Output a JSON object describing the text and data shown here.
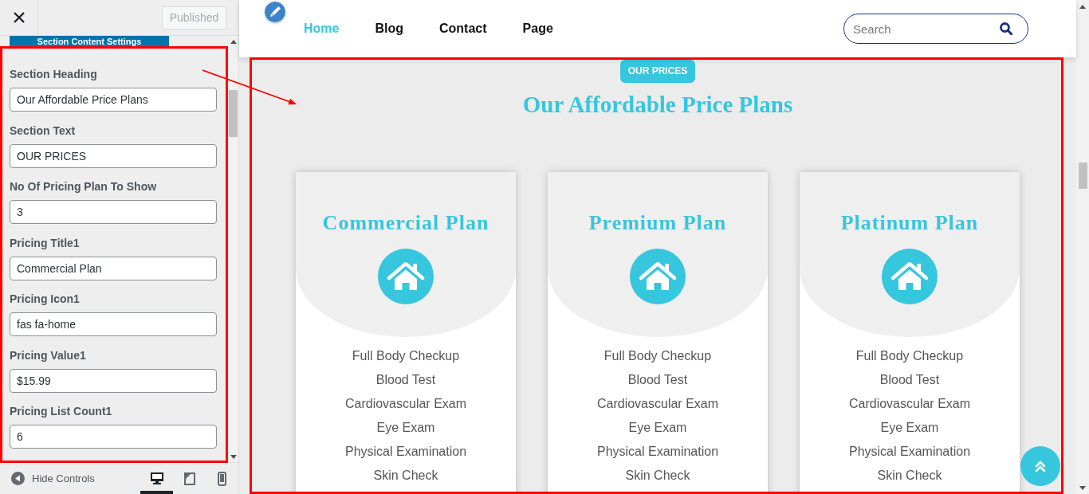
{
  "customizer": {
    "publish_button": {
      "label": "Published",
      "disabled": true
    },
    "section_title": "Section Content Settings",
    "fields": [
      {
        "label": "Section Heading",
        "value": "Our Affordable Price Plans"
      },
      {
        "label": "Section Text",
        "value": "OUR PRICES"
      },
      {
        "label": "No Of Pricing Plan To Show",
        "value": "3"
      },
      {
        "label": "Pricing Title1",
        "value": "Commercial Plan"
      },
      {
        "label": "Pricing Icon1",
        "value": "fas fa-home"
      },
      {
        "label": "Pricing Value1",
        "value": "$15.99"
      },
      {
        "label": "Pricing List Count1",
        "value": "6"
      }
    ],
    "footer": {
      "hide_controls": "Hide Controls",
      "devices": [
        {
          "kind": "desktop",
          "selected": true
        },
        {
          "kind": "tablet",
          "selected": false
        },
        {
          "kind": "mobile",
          "selected": false
        }
      ]
    }
  },
  "preview": {
    "nav": [
      {
        "label": "Home",
        "selected": true
      },
      {
        "label": "Blog",
        "selected": false
      },
      {
        "label": "Contact",
        "selected": false
      },
      {
        "label": "Page",
        "selected": false
      }
    ],
    "search": {
      "placeholder": "Search"
    },
    "pricing": {
      "badge": "OUR PRICES",
      "heading": "Our Affordable Price Plans",
      "plans": [
        {
          "title": "Commercial Plan",
          "features": [
            "Full Body Checkup",
            "Blood Test",
            "Cardiovascular Exam",
            "Eye Exam",
            "Physical Examination",
            "Skin Check"
          ]
        },
        {
          "title": "Premium Plan",
          "features": [
            "Full Body Checkup",
            "Blood Test",
            "Cardiovascular Exam",
            "Eye Exam",
            "Physical Examination",
            "Skin Check"
          ]
        },
        {
          "title": "Platinum Plan",
          "features": [
            "Full Body Checkup",
            "Blood Test",
            "Cardiovascular Exam",
            "Eye Exam",
            "Physical Examination",
            "Skin Check"
          ]
        }
      ]
    }
  }
}
